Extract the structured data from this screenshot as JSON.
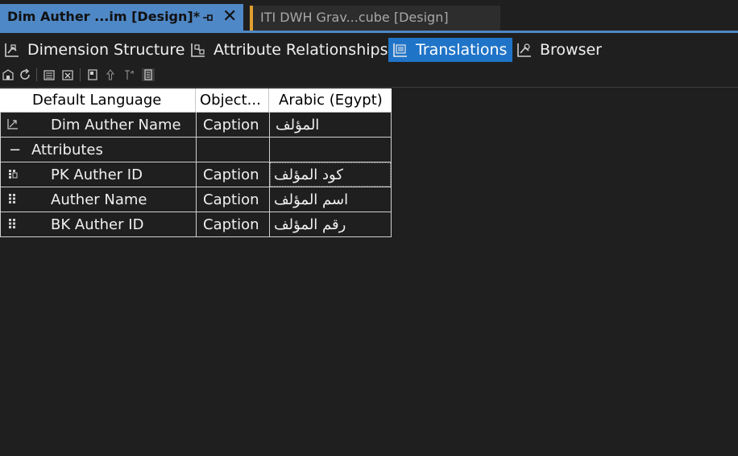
{
  "doc_tabs": {
    "active_title": "Dim Auther ...im [Design]*",
    "inactive_title": "ITI DWH Grav...cube [Design]",
    "close_glyph": "✕"
  },
  "designer_tabs": [
    {
      "label": "Dimension Structure",
      "icon": "dimension-structure-icon",
      "selected": false
    },
    {
      "label": "Attribute Relationships",
      "icon": "attribute-relationships-icon",
      "selected": false
    },
    {
      "label": "Translations",
      "icon": "translations-icon",
      "selected": true
    },
    {
      "label": "Browser",
      "icon": "browser-icon",
      "selected": false
    }
  ],
  "toolbar": {
    "icons": [
      "process-icon",
      "refresh-icon",
      "new-translation-icon",
      "delete-translation-icon",
      "edit-caption-icon",
      "move-up-icon",
      "move-down-icon",
      "show-all-icon"
    ]
  },
  "grid": {
    "headers": [
      "Default Language",
      "Object...",
      "Arabic (Egypt)"
    ],
    "rows": [
      {
        "icon": "dimension-icon",
        "name": "Dim Auther Name",
        "object": "Caption",
        "translation": "المؤلف"
      },
      {
        "icon": "collapse-icon",
        "name": "Attributes",
        "object": "",
        "translation": "",
        "expander": "−"
      },
      {
        "icon": "key-attribute-icon",
        "name": "PK Auther ID",
        "object": "Caption",
        "translation": "كود المؤلف"
      },
      {
        "icon": "attribute-icon",
        "name": "Auther Name",
        "object": "Caption",
        "translation": "اسم المؤلف"
      },
      {
        "icon": "attribute-icon",
        "name": "BK Auther ID",
        "object": "Caption",
        "translation": "رقم المؤلف"
      }
    ]
  },
  "colors": {
    "background": "#1f1f1f",
    "tab_accent": "#4f88c6",
    "selected_tab": "#1f74c8",
    "modified_marker": "#e0a030"
  }
}
